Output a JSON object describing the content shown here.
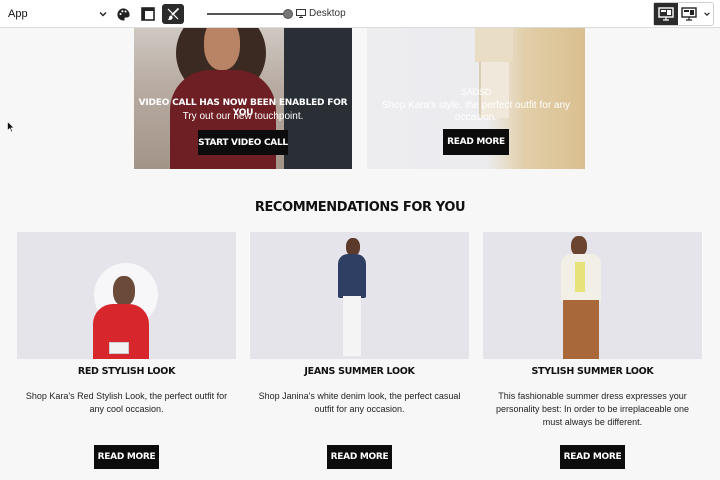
{
  "toolbar": {
    "app_select_value": "App",
    "device_label": "Desktop",
    "zoom_slider_level": 1.0
  },
  "hero_left": {
    "title": "VIDEO CALL HAS NOW BEEN ENABLED FOR YOU",
    "subtitle": "Try out our new touchpoint.",
    "button": "START VIDEO CALL"
  },
  "hero_right": {
    "title": "SADSD",
    "subtitle": "Shop Kara's style, the perfect outfit for any occasion.",
    "button": "READ MORE"
  },
  "recommendations": {
    "title": "RECOMMENDATIONS FOR YOU",
    "cards": [
      {
        "title": "RED STYLISH LOOK",
        "description": "Shop Kara's Red Stylish Look, the perfect outfit for any cool occasion.",
        "button": "READ MORE"
      },
      {
        "title": "JEANS SUMMER LOOK",
        "description": "Shop Janina's white denim look, the perfect casual outfit for any occasion.",
        "button": "READ MORE"
      },
      {
        "title": "STYLISH SUMMER LOOK",
        "description": "This fashionable summer dress expresses your personality best: In order to be irreplaceable one must always be different.",
        "button": "READ MORE"
      }
    ]
  },
  "colors": {
    "button_bg": "#0c0c0c",
    "page_bg": "#f7f7f8",
    "toolbar_active": "#2b2b2b"
  },
  "icons": [
    "chevron-down-icon",
    "palette-icon",
    "layout-icon",
    "brush-icon",
    "monitor-icon",
    "desktop-layout-icon",
    "mobile-layout-icon",
    "mouse-cursor-icon"
  ]
}
